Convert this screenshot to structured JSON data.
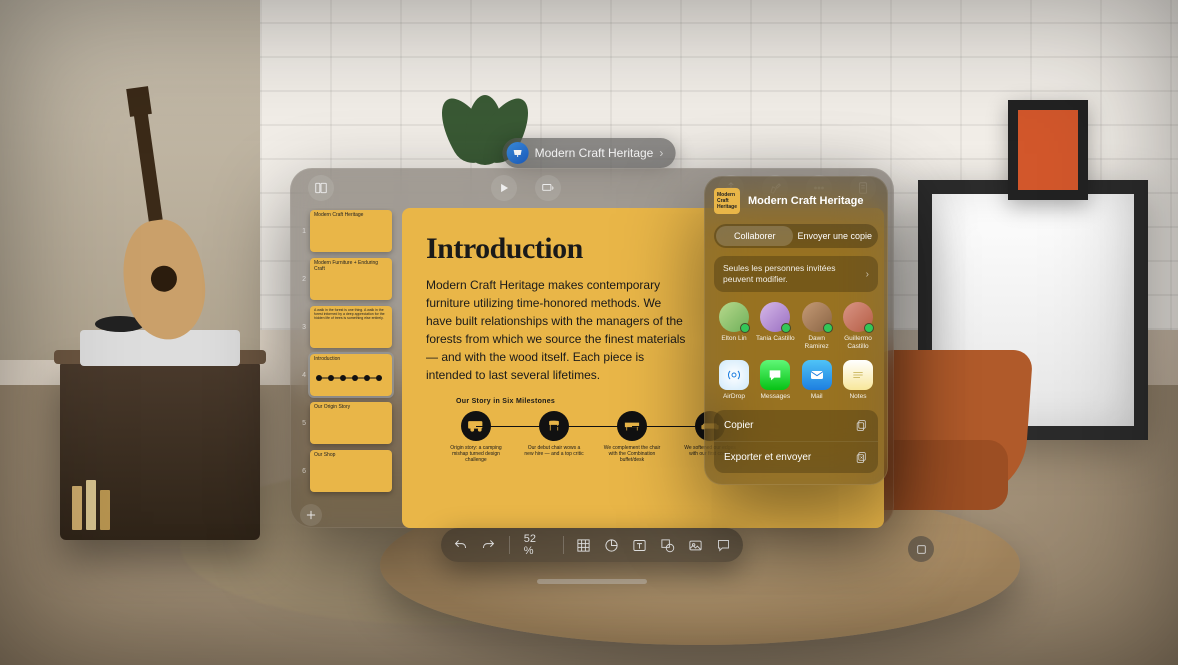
{
  "titlePill": {
    "label": "Modern Craft Heritage"
  },
  "slides": [
    {
      "num": "1",
      "title": "Modern Craft Heritage"
    },
    {
      "num": "2",
      "title": "Modern Furniture + Enduring Craft"
    },
    {
      "num": "3",
      "title": "A walk in the forest is one thing. A walk in the forest informed by a deep appreciation for the hidden life of trees is something else entirely."
    },
    {
      "num": "4",
      "title": "Introduction",
      "selected": true
    },
    {
      "num": "5",
      "title": "Our Origin Story"
    },
    {
      "num": "6",
      "title": "Our Shop"
    }
  ],
  "canvas": {
    "heading": "Introduction",
    "body": "Modern Craft Heritage makes contemporary furniture utilizing time-honored methods. We have built relationships with the managers of the forests from which we source the finest materials — and with the wood itself. Each piece is intended to last several lifetimes.",
    "subhead": "Our Story in Six Milestones",
    "milestones": [
      {
        "caption": "Origin story: a camping mishap turned design challenge"
      },
      {
        "caption": "Our debut chair wows a new hire — and a top critic"
      },
      {
        "caption": "We complement the chair with the Combination buffet/desk"
      },
      {
        "caption": "We softened our edges with our first couch"
      }
    ]
  },
  "zoom": "52 %",
  "bottomToolbar": {
    "undo": "undo",
    "redo": "redo",
    "table": "table",
    "chart": "chart",
    "text": "text",
    "shape": "shape",
    "media": "media",
    "comment": "comment"
  },
  "share": {
    "docTitle": "Modern Craft Heritage",
    "seg": {
      "collaborate": "Collaborer",
      "sendCopy": "Envoyer une copie"
    },
    "permissionText": "Seules les personnes invitées peuvent modifier.",
    "people": [
      {
        "name": "Elton Lin"
      },
      {
        "name": "Tania Castillo"
      },
      {
        "name": "Dawn Ramirez"
      },
      {
        "name": "Guillermo Castillo"
      }
    ],
    "apps": [
      {
        "name": "AirDrop"
      },
      {
        "name": "Messages"
      },
      {
        "name": "Mail"
      },
      {
        "name": "Notes"
      }
    ],
    "actions": {
      "copy": "Copier",
      "export": "Exporter et envoyer"
    }
  }
}
